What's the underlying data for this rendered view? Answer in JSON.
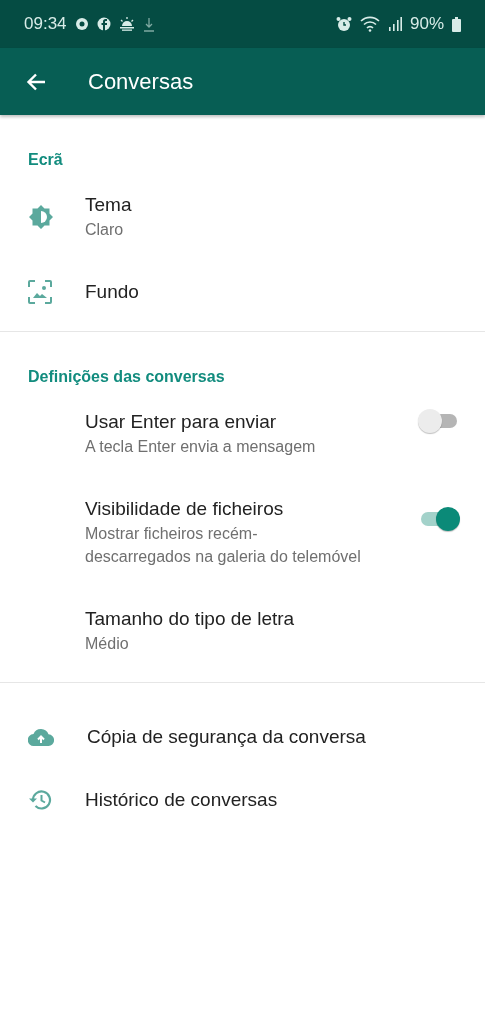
{
  "status_bar": {
    "time": "09:34",
    "battery": "90%"
  },
  "app_bar": {
    "title": "Conversas"
  },
  "sections": [
    {
      "title": "Ecrã",
      "items": [
        {
          "kind": "theme",
          "title": "Tema",
          "subtitle": "Claro"
        },
        {
          "kind": "wallpaper",
          "title": "Fundo"
        }
      ]
    },
    {
      "title": "Definições das conversas",
      "items": [
        {
          "kind": "toggle",
          "title": "Usar Enter para enviar",
          "subtitle": "A tecla Enter envia a mensagem",
          "on": false
        },
        {
          "kind": "toggle",
          "title": "Visibilidade de ficheiros",
          "subtitle": "Mostrar ficheiros recém-descarregados na galeria do telemóvel",
          "on": true
        },
        {
          "kind": "plain",
          "title": "Tamanho do tipo de letra",
          "subtitle": "Médio"
        }
      ]
    },
    {
      "items": [
        {
          "kind": "backup",
          "title": "Cópia de segurança da conversa"
        },
        {
          "kind": "history",
          "title": "Histórico de conversas"
        }
      ]
    }
  ]
}
